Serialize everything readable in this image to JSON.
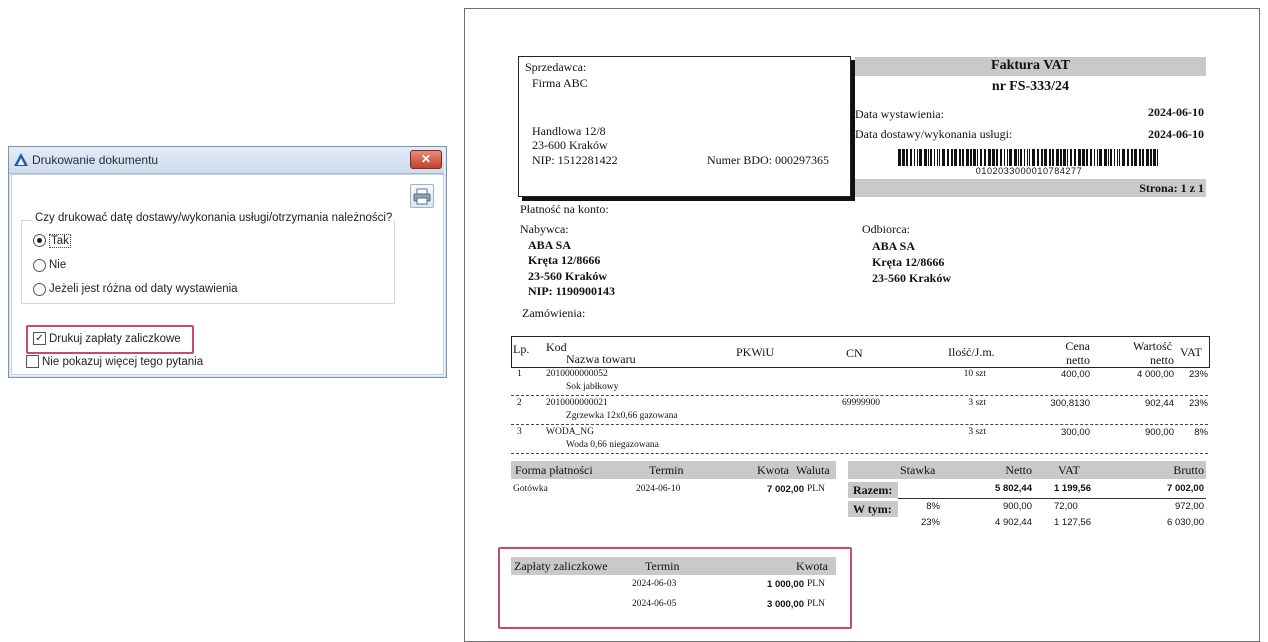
{
  "dialog": {
    "title": "Drukowanie dokumentu",
    "close_glyph": "✕",
    "question": "Czy drukować datę dostawy/wykonania usługi/otrzymania należności?",
    "options": [
      "Tak",
      "Nie",
      "Jeżeli jest różna od daty wystawienia"
    ],
    "selected_option": "Tak",
    "checkbox_advance": {
      "label": "Drukuj zapłaty zaliczkowe",
      "checked": true
    },
    "checkbox_dont_show": {
      "label": "Nie pokazuj więcej tego pytania",
      "checked": false
    },
    "icons": {
      "app": "comarch-triangle-icon",
      "print": "printer-icon"
    },
    "colors": {
      "highlight": "#c94b6a",
      "close": "#c3412e",
      "app_icon": "#1f5fa8"
    }
  },
  "invoice": {
    "seller": {
      "label": "Sprzedawca:",
      "name": "Firma ABC",
      "street": "Handlowa 12/8",
      "city": "23-600  Kraków",
      "nip": "NIP: 1512281422",
      "bdo": "Numer BDO: 000297365"
    },
    "title": "Faktura VAT",
    "number": "nr FS-333/24",
    "issue_date_label": "Data wystawienia:",
    "issue_date": "2024-06-10",
    "delivery_date_label": "Data dostawy/wykonania usługi:",
    "delivery_date": "2024-06-10",
    "barcode_text": "0102033000010784277",
    "page": "Strona: 1 z 1",
    "payment_method": "Płatność na konto:",
    "buyer": {
      "label": "Nabywca:",
      "name": "ABA SA",
      "street": "Kręta 12/8666",
      "city": "23-560  Kraków",
      "nip": "NIP: 1190900143"
    },
    "recipient": {
      "label": "Odbiorca:",
      "name": "ABA SA",
      "street": "Kręta 12/8666",
      "city": "23-560  Kraków"
    },
    "orders_label": "Zamówienia:",
    "table_headers": {
      "lp": "Lp.",
      "kod": "Kod",
      "nazwa": "Nazwa towaru",
      "pkwiu": "PKWiU",
      "cn": "CN",
      "ilosc": "Ilość/J.m.",
      "cena1": "Cena",
      "cena2": "netto",
      "wartosc1": "Wartość",
      "wartosc2": "netto",
      "vat": "VAT"
    },
    "items": [
      {
        "lp": "1",
        "kod": "2010000000052",
        "nazwa": "Sok jabłkowy",
        "cn": "",
        "ilosc": "10 szt",
        "cena": "400,00",
        "wartosc": "4 000,00",
        "vat": "23%"
      },
      {
        "lp": "2",
        "kod": "2010000000021",
        "nazwa": "Zgrzewka 12x0,66 gazowana",
        "cn": "69999900",
        "ilosc": "3 szt",
        "cena": "300,8130",
        "wartosc": "902,44",
        "vat": "23%"
      },
      {
        "lp": "3",
        "kod": "WODA_NG",
        "nazwa": "Woda  0,66 niegazowana",
        "cn": "",
        "ilosc": "3 szt",
        "cena": "300,00",
        "wartosc": "900,00",
        "vat": "8%"
      }
    ],
    "payment_table": {
      "headers": {
        "forma": "Forma płatności",
        "termin": "Termin",
        "kwota": "Kwota",
        "waluta": "Waluta"
      },
      "rows": [
        {
          "forma": "Gotówka",
          "termin": "2024-06-10",
          "kwota": "7 002,00",
          "waluta": "PLN"
        }
      ]
    },
    "vat_table": {
      "headers": {
        "stawka": "Stawka",
        "netto": "Netto",
        "vat": "VAT",
        "brutto": "Brutto"
      },
      "razem": {
        "label": "Razem:",
        "netto": "5 802,44",
        "vat": "1 199,56",
        "brutto": "7 002,00"
      },
      "wtym_label": "W tym:",
      "rows": [
        {
          "stawka": "8%",
          "netto": "900,00",
          "vat": "72,00",
          "brutto": "972,00"
        },
        {
          "stawka": "23%",
          "netto": "4 902,44",
          "vat": "1 127,56",
          "brutto": "6 030,00"
        }
      ]
    },
    "advance_table": {
      "headers": {
        "zaplaty": "Zapłaty zaliczkowe",
        "termin": "Termin",
        "kwota": "Kwota"
      },
      "rows": [
        {
          "termin": "2024-06-03",
          "kwota": "1 000,00",
          "waluta": "PLN"
        },
        {
          "termin": "2024-06-05",
          "kwota": "3 000,00",
          "waluta": "PLN"
        }
      ]
    }
  }
}
